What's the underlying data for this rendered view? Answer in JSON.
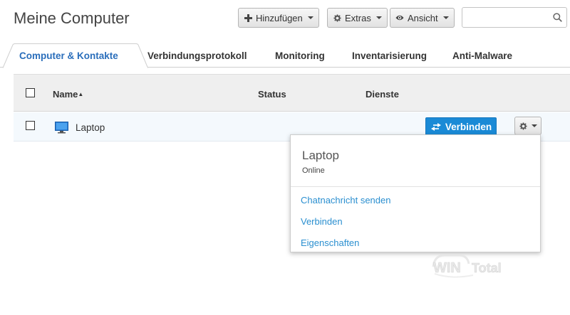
{
  "header": {
    "title": "Meine Computer",
    "buttons": {
      "add": {
        "label": "Hinzufügen",
        "icon": "plus-icon"
      },
      "extras": {
        "label": "Extras",
        "icon": "gear-icon"
      },
      "view": {
        "label": "Ansicht",
        "icon": "eye-icon"
      }
    },
    "search": {
      "value": "",
      "placeholder": ""
    }
  },
  "tabs": [
    {
      "label": "Computer & Kontakte",
      "active": true
    },
    {
      "label": "Verbindungsprotokoll",
      "active": false
    },
    {
      "label": "Monitoring",
      "active": false
    },
    {
      "label": "Inventarisierung",
      "active": false
    },
    {
      "label": "Anti-Malware",
      "active": false
    }
  ],
  "table": {
    "columns": {
      "name": "Name",
      "sort_indicator": "▲",
      "status": "Status",
      "services": "Dienste"
    },
    "rows": [
      {
        "name": "Laptop",
        "icon": "monitor-icon",
        "status": "",
        "action_label": "Verbinden"
      }
    ]
  },
  "context_menu": {
    "title": "Laptop",
    "status": "Online",
    "items": [
      {
        "label": "Chatnachricht senden"
      },
      {
        "label": "Verbinden"
      },
      {
        "label": "Eigenschaften"
      }
    ]
  },
  "colors": {
    "accent": "#2a6ebb",
    "primary_button": "#1a8ad6",
    "link": "#2a8fd0"
  },
  "watermark": "WINTotal"
}
